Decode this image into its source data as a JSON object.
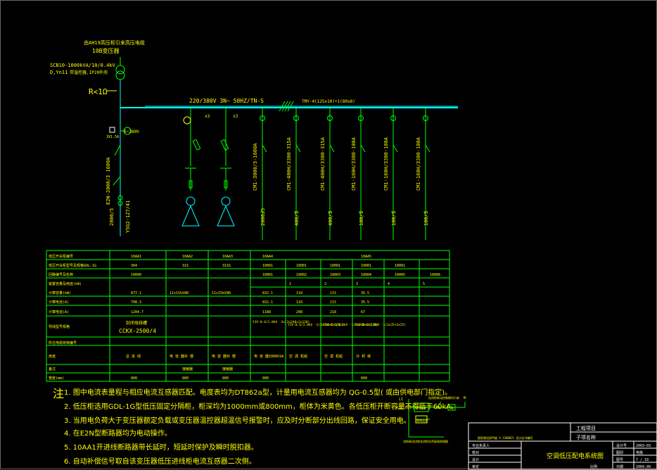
{
  "header": {
    "transformer_note": "由AH19高压柜引来高压电缆",
    "bus_label": "10B变压器",
    "transformer_spec_1": "SCB10-1000kVA/10/0.4kV",
    "transformer_spec_2": "D,Yn11",
    "transformer_spec_3": "带温控器,IP20外壳",
    "grounding": "R<1Ω",
    "bus_spec": "220/380V 3N~ 50HZ/TN-S",
    "busway_spec": "TMY-4(125x10)+1(80x8)",
    "meter_range": "0~380V",
    "meter_range_2": "3X1.5A",
    "incoming_breaker": "E2N-2000/3 1600A",
    "incoming_ct": "2000/5",
    "ct_spec": "Y5G2-127/41"
  },
  "branches": [
    {
      "breaker": "CM1-3000/3-1600A",
      "ct": "2000/5"
    },
    {
      "breaker": "CM1-400H/3300-315A",
      "ct": "400/5"
    },
    {
      "breaker": "CM1-400H/3300-315A",
      "ct": "400/5"
    },
    {
      "breaker": "CM1-160H/3300-100A",
      "ct": "100/5"
    },
    {
      "breaker": "CM1-160H/3300-100A",
      "ct": "100/5"
    },
    {
      "breaker": "CM1-160H/3300-100A",
      "ct": "100/5"
    }
  ],
  "capacitor": {
    "label_1": "x3",
    "label_2": "x3"
  },
  "table": {
    "row_labels": [
      "低压开关柜编号",
      "低压开关柜型号及规格GDL-1G",
      "回路编号及名称",
      "装置容量及用途(kW)",
      "",
      "计算容量(kW)",
      "计算电流(A)",
      "计算电流(A)",
      "导线型号规格",
      "",
      "所在电缆桥架编号",
      "用途",
      "备注",
      "宽度(mm)"
    ],
    "cabinets": [
      "10AA1",
      "10AA2",
      "10AA3",
      "10AA4",
      "10AA5"
    ],
    "models": [
      "304",
      "31S",
      "31SS",
      "10001",
      "10001",
      "10001",
      "10001",
      "10001"
    ],
    "circuits": [
      "10000",
      "10001",
      "10002",
      "10003",
      "10004",
      "10005",
      "10006"
    ],
    "sub_nums": [
      "1",
      "2",
      "3",
      "4",
      "5"
    ],
    "power": [
      "877.1",
      "11x15kVAR",
      "11x15kVAR",
      "832.1",
      "110",
      "115",
      "35.5"
    ],
    "power2": [
      "798.3",
      "832.1",
      "110",
      "115",
      "35.5"
    ],
    "current": [
      "1204.7",
      "1188",
      "208",
      "218",
      "67"
    ],
    "busway": "封闭母线槽",
    "busway_model": "CCKX-2500/4",
    "cable_1": "YJV-0.6/1.0kV -3x(3x240+2x120)",
    "cable_2": "YJV-0.6/1.0kV -1(3x240+2x120)",
    "cable_3": "YJV-0.6/1.0kV -1(3x240+2x120)",
    "cable_4": "YJV-0.6/1.0kV -1(3x35+2x25)",
    "uses": [
      "总 进 线",
      "电 容 器补 偿",
      "电 容 器补 偿",
      "电 容 器1000kVA",
      "空 调 机组",
      "空 调 机组",
      "冷 却 塔"
    ],
    "remarks": [
      "",
      "接触器",
      "接触器"
    ],
    "widths": [
      "800",
      "800",
      "800",
      "800",
      "800"
    ]
  },
  "notes": {
    "mark": "注",
    "lines": [
      "1. 图中电流表量程与相应电流互感器匹配。电度表均为DT862a型，计量用电流互感器均为 QG-0.5型( 或由供电部门指定)。",
      "2. 低压柜选用GDL-1G型低压固定分隔柜，柜深均为1000mm或800mm，柜体为米黄色。各低压柜开断容量不得低于60kA。",
      "3. 当用电负荷大于变压器额定负载或变压器温控器超温信号报警时，应及时分断部分出线回路，保证安全用电。",
      "4. 在E2N型断路器均为电动操作。",
      "5. 10AA1开进线断路器带长延时，短延时保护及瞬时脱扣器。",
      "6. 自动补偿信号取自该变压器低压进线柜电流互感器二次侧。"
    ]
  },
  "control_sketch": {
    "l1": "L1",
    "n": "N",
    "label_1": "RL2L-3X/2",
    "label_2": "欠电保护",
    "label_3": "ZK",
    "label_4": "FD",
    "label_5": "跳闸连锁",
    "caption": "消防联动切除非消防负荷接线原理图",
    "top_label": "由消防联动控制模块引来"
  },
  "title_block": {
    "project_name": "工程项目",
    "sub_project": "子项名称",
    "drawing_title": "空调低压配电系统图",
    "cert": "国家建设部甲级 A 2200021 设计证书编号",
    "roles": [
      "专业负责人",
      "校对",
      "设计"
    ],
    "fields": [
      "设计号",
      "图别",
      "图号",
      "日期"
    ],
    "values": [
      "2003-03",
      "电施",
      "7 / 10",
      "2004.09"
    ],
    "scale": "比例",
    "approver": "审定"
  },
  "colors": {
    "bus": "#00ffff",
    "component": "#00ff00",
    "text": "#ffff00",
    "table": "#00ff00",
    "frame": "#ffffff"
  }
}
